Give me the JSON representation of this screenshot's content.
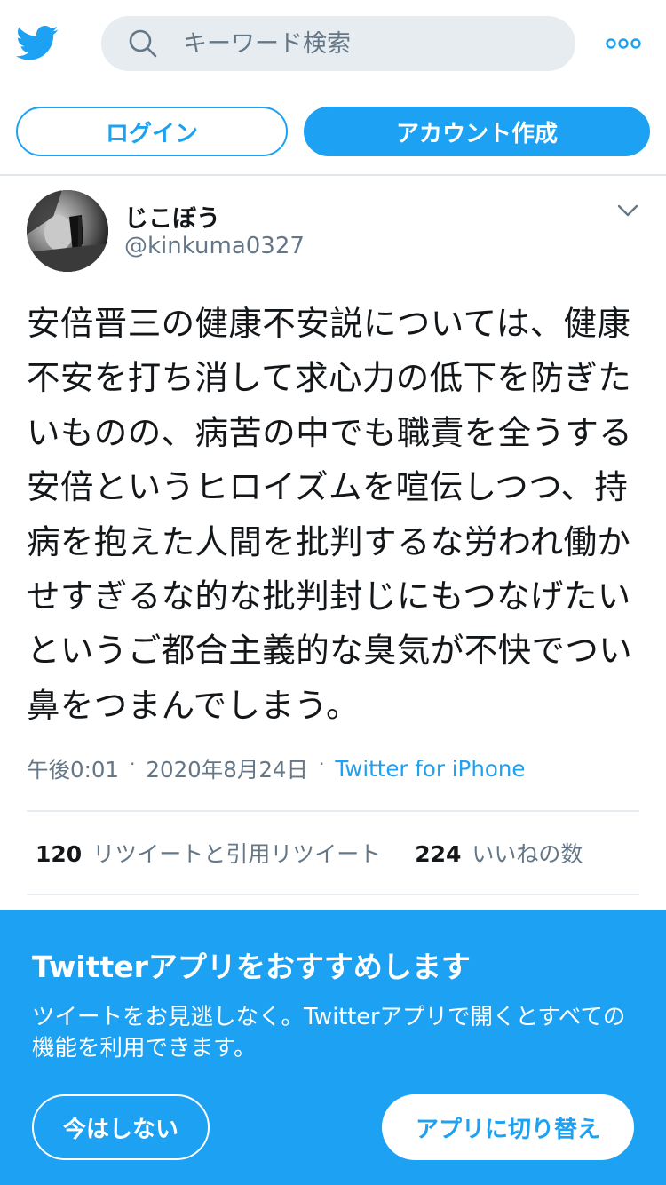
{
  "colors": {
    "brand": "#1da1f2",
    "text_primary": "#14171a",
    "text_secondary": "#657786",
    "search_bg": "#e6ecf0"
  },
  "header": {
    "logo_icon": "twitter-bird-icon",
    "search_icon": "search-icon",
    "search_placeholder": "キーワード検索",
    "more_icon": "more-dots-icon"
  },
  "auth": {
    "login_label": "ログイン",
    "signup_label": "アカウント作成"
  },
  "tweet": {
    "display_name": "じこぼう",
    "handle": "@kinkuma0327",
    "menu_icon": "chevron-down-icon",
    "text": "安倍晋三の健康不安説については、健康不安を打ち消して求心力の低下を防ぎたいものの、病苦の中でも職責を全うする安倍というヒロイズムを喧伝しつつ、持病を抱えた人間を批判するな労われ働かせすぎるな的な批判封じにもつなげたいというご都合主義的な臭気が不快でつい鼻をつまんでしまう。",
    "time": "午後0:01",
    "date": "2020年8月24日",
    "source": "Twitter for iPhone",
    "separator": "·",
    "retweets_count": "120",
    "retweets_label": "リツイートと引用リツイート",
    "likes_count": "224",
    "likes_label": "いいねの数"
  },
  "promo": {
    "title": "Twitterアプリをおすすめします",
    "description": "ツイートをお見逃しなく。Twitterアプリで開くとすべての機能を利用できます。",
    "not_now_label": "今はしない",
    "switch_label": "アプリに切り替え"
  }
}
